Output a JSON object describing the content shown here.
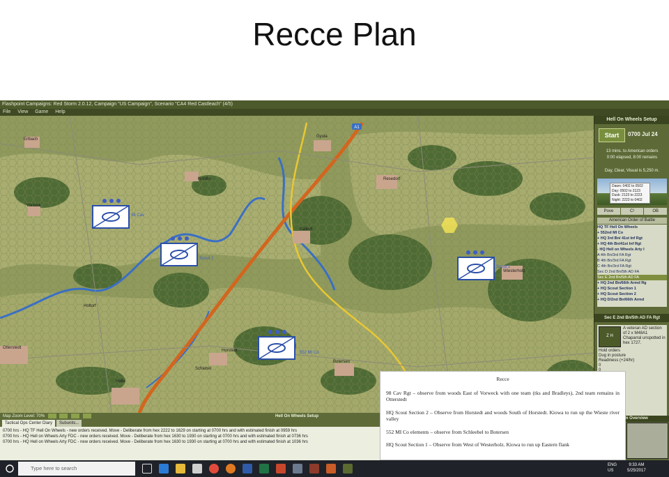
{
  "slide": {
    "title": "Recce Plan"
  },
  "window": {
    "title": "Flashpoint Campaigns: Red Storm 2.0.12, Campaign \"US Campaign\", Scenario \"CA4 Red Castleach\" (4/5)",
    "menu": [
      "File",
      "View",
      "Game",
      "Help"
    ]
  },
  "map": {
    "towns": [
      "Erlbach",
      "Vorwick",
      "Nordlis",
      "Gyula",
      "Resedorf",
      "Kalledt",
      "Wiesterholz",
      "Horstedt",
      "Schlebel",
      "Botersen",
      "Otterstedt",
      "Holtorf",
      "Halle"
    ],
    "road_marker": "A1",
    "units": [
      {
        "name": "98 Cav Rgt",
        "label": "98 Cav"
      },
      {
        "name": "HQ Scout Section 2",
        "label": "Scout 2"
      },
      {
        "name": "552 MI Co",
        "label": "552 MI Co"
      },
      {
        "name": "HQ Scout Section 1",
        "label": "Scout 1"
      }
    ]
  },
  "sidebar": {
    "header": "Hell On Wheels Setup",
    "start_label": "Start",
    "clock": "0700 Jul 24",
    "orders_line": "13 mins. to American orders",
    "elapsed_line": "0:00 elapsed, 8:00 remains",
    "weather_line": "Day, Clear, Visual is 5,250 m.",
    "daylight": [
      "Dawn: 0402 to 0502",
      "Day: 0502 to 2123",
      "Dusk: 2123 to 2223",
      "Night: 2223 to 0402"
    ],
    "tabs": [
      "Pove",
      "C!",
      "OB"
    ],
    "oob_title": "American Order of Battle",
    "oob_items": [
      {
        "text": "HQ TF Hell On Wheels",
        "bold": true
      },
      {
        "text": "+ 552nd MI Co",
        "bold": true
      },
      {
        "text": "+ HQ 3rd Bn/ 41st Inf Rgt",
        "bold": true
      },
      {
        "text": "+ HQ 4th Bn/41st Inf Rgt",
        "bold": true
      },
      {
        "text": "- HQ Hell on Wheels Arty I",
        "bold": true
      },
      {
        "text": "   A 4th Bn/3rd FA Rgt",
        "bold": false
      },
      {
        "text": "   B 4th Bn/3rd FA Rgt",
        "bold": false
      },
      {
        "text": "   C 4th Bn/3rd FA Rgt",
        "bold": false
      },
      {
        "text": "   Sec D 2nd Bn/5th AD FA",
        "bold": false
      },
      {
        "text": "   Sec E 2nd Bn/5th AD FA",
        "bold": false,
        "selected": true
      },
      {
        "text": "+ HQ 2nd Bn/66th Armd Rg",
        "bold": true
      },
      {
        "text": "+ HQ Scout Section 1",
        "bold": true
      },
      {
        "text": "+ HQ Scout Section 2",
        "bold": true
      },
      {
        "text": "+ HQ D/2nd Bn/66th Armd",
        "bold": true
      }
    ],
    "unit_header": "Sec E 2nd Bn/5th AD FA Rgt",
    "unit_desc": "A veteran AD section of 2 x M48A1 Chaparral unspotted in hex 1727.",
    "unit_lines": [
      "Hold orders",
      "Dug in posture",
      "Readiness (+24/hr)",
      "0",
      "0",
      "ns from HQ",
      "toff: 0 hexes"
    ],
    "minimap_header": "Storm Overview"
  },
  "bottom": {
    "zoom_label": "Map Zoom Level: 70%",
    "setup_label": "Hell On Wheels Setup",
    "tabs": [
      "Tactical Ops Center Diary",
      "Subunits..."
    ],
    "log": [
      "0700 hrs - HQ TF Hell On Wheels - new orders received. Move - Deliberate from hex 2222 to 1629 on starting at 0700 hrs and with estimated finish at 0959 hrs",
      "0700 hrs - HQ Hell on Wheels Arty FDC - new orders received. Move - Deliberate from hex 1630 to 1930 on starting at 0700 hrs and with estimated finish at 0736 hrs",
      "0700 hrs - HQ Hell on Wheels Arty FDC - new orders received. Move - Deliberate from hex 1630 to 1930 on starting at 0700 hrs and with estimated finish at 1036 hrs"
    ]
  },
  "note": {
    "title": "Recce",
    "items": [
      "98 Cav Rgt – observe from woods East of Vorweck with one team (tks and Bradleys), 2nd team remains in Otterstedt",
      "HQ Scout Section 2 – Observe from Horstedt and woods South of Horstedt. Kiowa to run up the Wieste river valley",
      "552 MI Co elements – observe from Schleebel to Botersen",
      "HQ Scout Section 1 – Observe from West of Westerholz. Kiowa to run up Eastern flank"
    ]
  },
  "taskbar": {
    "search_placeholder": "Type here to search",
    "lang": [
      "ENG",
      "US"
    ],
    "time": "9:33 AM",
    "date": "5/25/2017"
  }
}
